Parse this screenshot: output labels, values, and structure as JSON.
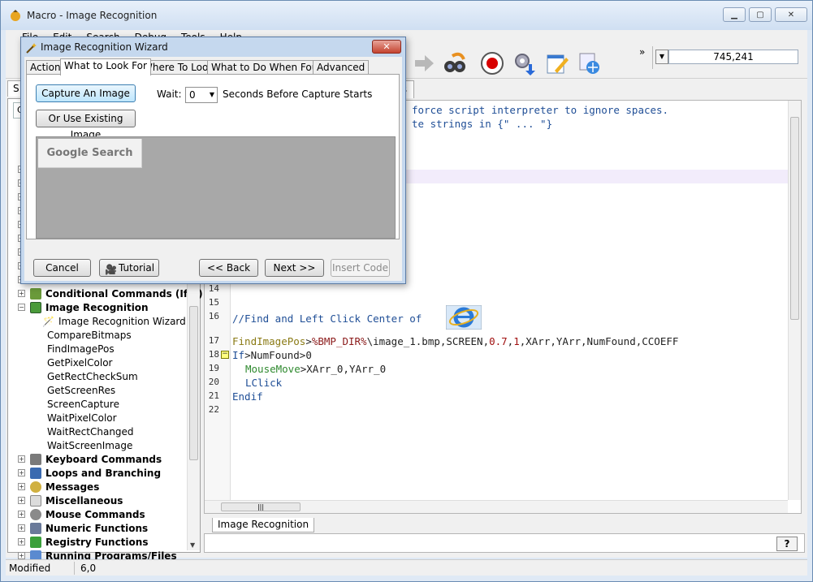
{
  "app": {
    "title": "Macro - Image Recognition"
  },
  "caption": {
    "minimize": "▁",
    "maximize": "▢",
    "close": "✕"
  },
  "menu": [
    "File",
    "Edit",
    "Search",
    "Debug",
    "Tools",
    "Help"
  ],
  "toolbar": {
    "coords": "745,241",
    "overflow": "»"
  },
  "left_tabs": [
    "S",
    "C"
  ],
  "tree": {
    "categories_above": [
      "",
      "",
      "",
      "",
      "",
      "",
      "",
      "",
      "",
      ""
    ],
    "conditional": "Conditional Commands (If...)",
    "image_recognition": "Image Recognition",
    "image_recognition_items": [
      "Image Recognition Wizard",
      "CompareBitmaps",
      "FindImagePos",
      "GetPixelColor",
      "GetRectCheckSum",
      "GetScreenRes",
      "ScreenCapture",
      "WaitPixelColor",
      "WaitRectChanged",
      "WaitScreenImage"
    ],
    "categories_below": [
      "Keyboard Commands",
      "Loops and Branching",
      "Messages",
      "Miscellaneous",
      "Mouse Commands",
      "Numeric Functions",
      "Registry Functions",
      "Running Programs/Files"
    ]
  },
  "editor": {
    "tab_visible_fragment": "ts",
    "lines": {
      "l1_fragment": "force script interpreter to ignore spaces.",
      "l2_fragment": "te strings in {\" ... \"}",
      "ln14": "14",
      "ln15": "15",
      "ln16": "16",
      "ln17": "17",
      "ln18": "18",
      "ln19": "19",
      "ln20": "20",
      "ln21": "21",
      "ln22": "22",
      "comment": "//Find and Left Click Center of",
      "find_cmd": "FindImagePos",
      "find_arg_var": "%BMP_DIR%",
      "find_args": "\\image_1.bmp,SCREEN,",
      "find_num1": "0.7",
      "find_num2": "1",
      "find_rest": ",XArr,YArr,NumFound,CCOEFF",
      "if_kw": "If",
      "if_cond": "NumFound>0",
      "mouse_cmd": "MouseMove",
      "mouse_args": "XArr_0,YArr_0",
      "lclick": "LClick",
      "endif": "Endif"
    }
  },
  "bottom_tab": "Image Recognition",
  "help_button": "?",
  "status": {
    "state": "Modified",
    "position": "6,0"
  },
  "wizard": {
    "title": "Image Recognition Wizard",
    "close": "✕",
    "tabs": [
      "Action",
      "What to Look For",
      "Where To Look",
      "What to Do When Found",
      "Advanced"
    ],
    "active_tab": "What to Look For",
    "capture_button": "Capture An Image",
    "existing_button": "Or Use Existing Image",
    "wait_label": "Wait:",
    "wait_value": "0",
    "wait_suffix": "Seconds Before Capture Starts",
    "preview_text": "Google Search",
    "buttons": {
      "cancel": "Cancel",
      "tutorial": "Tutorial",
      "back": "<< Back",
      "next": "Next >>",
      "insert": "Insert Code"
    }
  },
  "colors": {
    "comment": "#1f4e96",
    "command": "#8a7a14",
    "variable": "#8b1a1a",
    "subcommand": "#2f8a2f",
    "highlight_line": "#f2ecfb",
    "wizard_frame": "#c5d8ee"
  }
}
